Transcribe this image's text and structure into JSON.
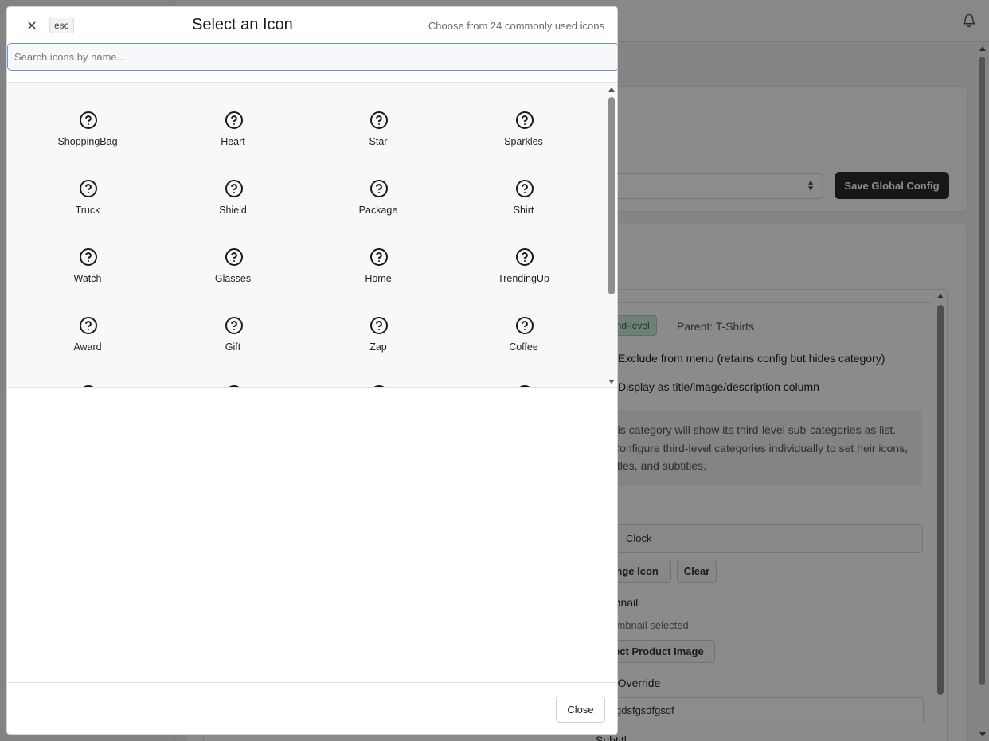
{
  "background": {
    "save_button": "Save Global Config",
    "badge": "cond-level",
    "parent_text": "Parent: T-Shirts",
    "exclude_label": "Exclude from menu (retains config but hides category)",
    "display_label": "Display as title/image/description column",
    "info_text": "his category will show its third-level sub-categories as list. Configure third-level categories individually to set heir icons, titles, and subtitles.",
    "icon_field_value": "Clock",
    "change_icon_button": "ange Icon",
    "clear_button": "Clear",
    "thumbnail_label": "mbnail",
    "thumbnail_sub": "humbnail selected",
    "select_image_button": "ect Product Image",
    "title_override_label": "e Override",
    "title_override_value": "gdsfgsdfgsdf",
    "subtitle_label": "Subtitl"
  },
  "modal": {
    "esc": "esc",
    "title": "Select an Icon",
    "subtitle": "Choose from 24 commonly used icons",
    "search_placeholder": "Search icons by name...",
    "icons": [
      "ShoppingBag",
      "Heart",
      "Star",
      "Sparkles",
      "Truck",
      "Shield",
      "Package",
      "Shirt",
      "Watch",
      "Glasses",
      "Home",
      "TrendingUp",
      "Award",
      "Gift",
      "Zap",
      "Coffee",
      "",
      "",
      "",
      ""
    ],
    "close_button": "Close"
  }
}
